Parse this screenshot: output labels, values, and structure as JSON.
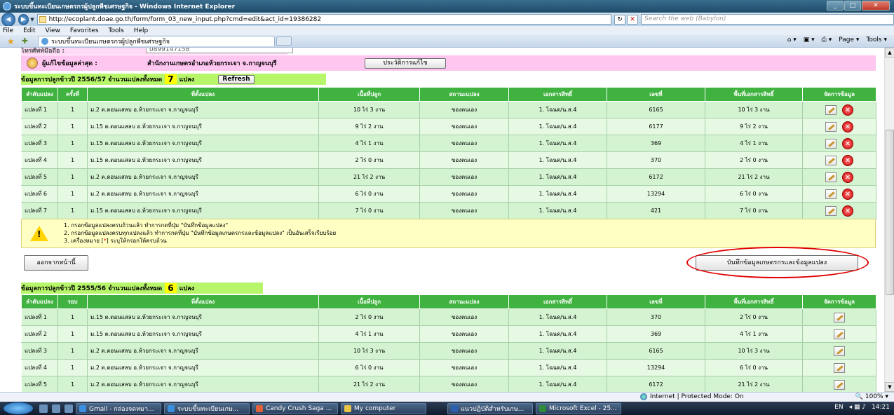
{
  "window": {
    "title": "ระบบขึ้นทะเบียนเกษตรกรผู้ปลูกพืชเศรษฐกิจ - Windows Internet Explorer",
    "url": "http://ecoplant.doae.go.th/form/form_03_new_input.php?cmd=edit&act_id=19386282",
    "search_placeholder": "Search the web (Babylon)",
    "tab_label": "ระบบขึ้นทะเบียนเกษตรกรผู้ปลูกพืชเศรษฐกิจ",
    "menu": [
      "File",
      "Edit",
      "View",
      "Favorites",
      "Tools",
      "Help"
    ],
    "commands": [
      "Page ▾",
      "Tools ▾"
    ]
  },
  "editor": {
    "partial_label": "โทรศัพท์มือถือ :",
    "partial_value": "0899147158",
    "label": "ผู้แก้ไขข้อมูลล่าสุด :",
    "value": "สำนักงานเกษตรอำเภอห้วยกระเจา จ.กาญจนบุรี",
    "history_button": "ประวัติการแก้ไข"
  },
  "season1": {
    "title_prefix": "ข้อมูลการปลูกข้าวปี 2556/57 จำนวนแปลงทั้งหมด",
    "count": "7",
    "unit": "แปลง",
    "refresh": "Refresh",
    "headers": [
      "ลำดับแปลง",
      "ครั้งที่",
      "ที่ตั้งแปลง",
      "เนื้อที่ปลูก",
      "สถานะแปลง",
      "เอกสารสิทธิ์",
      "เลขที่",
      "พื้นที่เอกสารสิทธิ์",
      "จัดการข้อมูล"
    ],
    "rows": [
      [
        "แปลงที่ 1",
        "1",
        "ม.2 ต.ดอนแสลบ อ.ห้วยกระเจา จ.กาญจนบุรี",
        "10 ไร่ 3 งาน",
        "ของตนเอง",
        "1. โฉนด/น.ส.4",
        "6165",
        "10 ไร่ 3 งาน"
      ],
      [
        "แปลงที่ 2",
        "1",
        "ม.15 ต.ดอนแสลบ อ.ห้วยกระเจา จ.กาญจนบุรี",
        "9 ไร่ 2 งาน",
        "ของตนเอง",
        "1. โฉนด/น.ส.4",
        "6177",
        "9 ไร่ 2 งาน"
      ],
      [
        "แปลงที่ 3",
        "1",
        "ม.15 ต.ดอนแสลบ อ.ห้วยกระเจา จ.กาญจนบุรี",
        "4 ไร่ 1 งาน",
        "ของตนเอง",
        "1. โฉนด/น.ส.4",
        "369",
        "4 ไร่ 1 งาน"
      ],
      [
        "แปลงที่ 4",
        "1",
        "ม.15 ต.ดอนแสลบ อ.ห้วยกระเจา จ.กาญจนบุรี",
        "2 ไร่ 0 งาน",
        "ของตนเอง",
        "1. โฉนด/น.ส.4",
        "370",
        "2 ไร่ 0 งาน"
      ],
      [
        "แปลงที่ 5",
        "1",
        "ม.2 ต.ดอนแสลบ อ.ห้วยกระเจา จ.กาญจนบุรี",
        "21 ไร่ 2 งาน",
        "ของตนเอง",
        "1. โฉนด/น.ส.4",
        "6172",
        "21 ไร่ 2 งาน"
      ],
      [
        "แปลงที่ 6",
        "1",
        "ม.2 ต.ดอนแสลบ อ.ห้วยกระเจา จ.กาญจนบุรี",
        "6 ไร่ 0 งาน",
        "ของตนเอง",
        "1. โฉนด/น.ส.4",
        "13294",
        "6 ไร่ 0 งาน"
      ],
      [
        "แปลงที่ 7",
        "1",
        "ม.15 ต.ดอนแสลบ อ.ห้วยกระเจา จ.กาญจนบุรี",
        "7 ไร่ 0 งาน",
        "ของตนเอง",
        "1. โฉนด/น.ส.4",
        "421",
        "7 ไร่ 0 งาน"
      ]
    ]
  },
  "notice": {
    "line1": "1. กรอกข้อมูลแปลงครบถ้วนแล้ว ทำการกดที่ปุ่ม \"บันทึกข้อมูลแปลง\"",
    "line2": "2. กรอกข้อมูลแปลงครบทุกแปลงแล้ว ทำการกดที่ปุ่ม \"บันทึกข้อมูลเกษตรกรและข้อมูลแปลง\" เป็นอันเสร็จเรียบร้อย",
    "line3_pre": "3. เครื่องหมาย [",
    "line3_star": "*",
    "line3_post": "] ระบุให้กรอกให้ครบถ้วน"
  },
  "actions": {
    "exit": "ออกจากหน้านี้",
    "save": "บันทึกข้อมูลเกษตรกรและข้อมูลแปลง"
  },
  "season2": {
    "title_prefix": "ข้อมูลการปลูกข้าวปี 2555/56 จำนวนแปลงทั้งหมด",
    "count": "6",
    "unit": "แปลง",
    "headers": [
      "ลำดับแปลง",
      "รอบ",
      "ที่ตั้งแปลง",
      "เนื้อที่ปลูก",
      "สถานะแปลง",
      "เอกสารสิทธิ์",
      "เลขที่",
      "พื้นที่เอกสารสิทธิ์",
      "จัดการข้อมูล"
    ],
    "rows": [
      [
        "แปลงที่ 1",
        "1",
        "ม.15 ต.ดอนแสลบ อ.ห้วยกระเจา จ.กาญจนบุรี",
        "2 ไร่ 0 งาน",
        "ของตนเอง",
        "1. โฉนด/น.ส.4",
        "370",
        "2 ไร่ 0 งาน"
      ],
      [
        "แปลงที่ 2",
        "1",
        "ม.15 ต.ดอนแสลบ อ.ห้วยกระเจา จ.กาญจนบุรี",
        "4 ไร่ 1 งาน",
        "ของตนเอง",
        "1. โฉนด/น.ส.4",
        "369",
        "4 ไร่ 1 งาน"
      ],
      [
        "แปลงที่ 3",
        "1",
        "ม.2 ต.ดอนแสลบ อ.ห้วยกระเจา จ.กาญจนบุรี",
        "10 ไร่ 3 งาน",
        "ของตนเอง",
        "1. โฉนด/น.ส.4",
        "6165",
        "10 ไร่ 3 งาน"
      ],
      [
        "แปลงที่ 4",
        "1",
        "ม.2 ต.ดอนแสลบ อ.ห้วยกระเจา จ.กาญจนบุรี",
        "6 ไร่ 0 งาน",
        "ของตนเอง",
        "1. โฉนด/น.ส.4",
        "13294",
        "6 ไร่ 0 งาน"
      ],
      [
        "แปลงที่ 5",
        "1",
        "ม.2 ต.ดอนแสลบ อ.ห้วยกระเจา จ.กาญจนบุรี",
        "21 ไร่ 2 งาน",
        "ของตนเอง",
        "1. โฉนด/น.ส.4",
        "6172",
        "21 ไร่ 2 งาน"
      ]
    ]
  },
  "status": {
    "zone": "Internet | Protected Mode: On",
    "zoom": "100%"
  },
  "taskbar": {
    "buttons": [
      "Gmail - กล่องจดหมา...",
      "ระบบขึ้นทะเบียนเกษ...",
      "Candy Crush Saga ...",
      "My computer",
      "แนวปฏิบัติสำหรับเกษ...",
      "Microsoft Excel - 25..."
    ],
    "lang": "EN",
    "time": "14:21"
  }
}
